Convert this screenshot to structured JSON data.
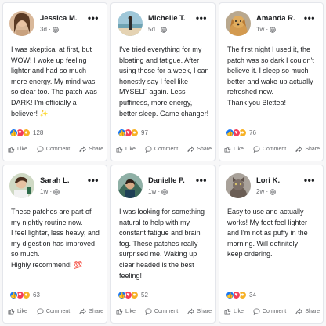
{
  "posts": [
    {
      "name": "Jessica M.",
      "time": "3d ·",
      "lines": [
        "I was skeptical at first, but",
        "WOW! I woke up feeling",
        "lighter and had so much",
        "more energy. My mind was",
        "so clear too. The patch was",
        "DARK! I'm officially a",
        "believer! ✨"
      ],
      "reaction_count": "128",
      "like": "Like",
      "comment": "Comment",
      "share": "Share"
    },
    {
      "name": "Michelle T.",
      "time": "5d ·",
      "lines": [
        "I've tried everything for my",
        "bloating and fatigue. After",
        "using these for a week, I can",
        "honestly say I feel like",
        "MYSELF again. Less",
        "puffiness, more energy,",
        "better sleep. Game changer!"
      ],
      "reaction_count": "97",
      "like": "Like",
      "comment": "Comment",
      "share": "Share"
    },
    {
      "name": "Amanda R.",
      "time": "1w ·",
      "lines": [
        "The first night I used it, the",
        "patch was so dark I couldn't",
        "believe it. I sleep so much",
        "better and wake up actually",
        "refreshed now.",
        "Thank you Blettea!"
      ],
      "reaction_count": "76",
      "like": "Like",
      "comment": "Comment",
      "share": "Share"
    },
    {
      "name": "Sarah L.",
      "time": "1w ·",
      "lines": [
        "These patches are part of",
        "my nightly routine now.",
        "I feel lighter, less heavy, and",
        "my digestion has improved",
        "so much.",
        "Highly recommend! 💯"
      ],
      "reaction_count": "63",
      "like": "Like",
      "comment": "Comment",
      "share": "Share"
    },
    {
      "name": "Danielle P.",
      "time": "1w ·",
      "lines": [
        "I was looking for something",
        "natural to help with my",
        "constant fatigue and brain",
        "fog. These patches really",
        "surprised me. Waking up",
        "clear headed is the best",
        "feeling!"
      ],
      "reaction_count": "52",
      "like": "Like",
      "comment": "Comment",
      "share": "Share"
    },
    {
      "name": "Lori K.",
      "time": "2w ·",
      "lines": [
        "Easy to use and actually",
        "works! My feet feel lighter",
        "and I'm not as puffy in the",
        "morning. Will definitely",
        "keep ordering."
      ],
      "reaction_count": "34",
      "like": "Like",
      "comment": "Comment",
      "share": "Share"
    }
  ],
  "icons": {
    "more": "more-options-icon",
    "globe": "globe-icon",
    "like": "thumbs-up-icon",
    "love": "heart-icon",
    "wow": "wow-face-icon",
    "comment": "speech-bubble-icon",
    "share": "share-arrow-icon"
  },
  "colors": {
    "like": "#1877f2",
    "love": "#f33e58",
    "wow": "#f7b125",
    "muted": "#65676b"
  }
}
